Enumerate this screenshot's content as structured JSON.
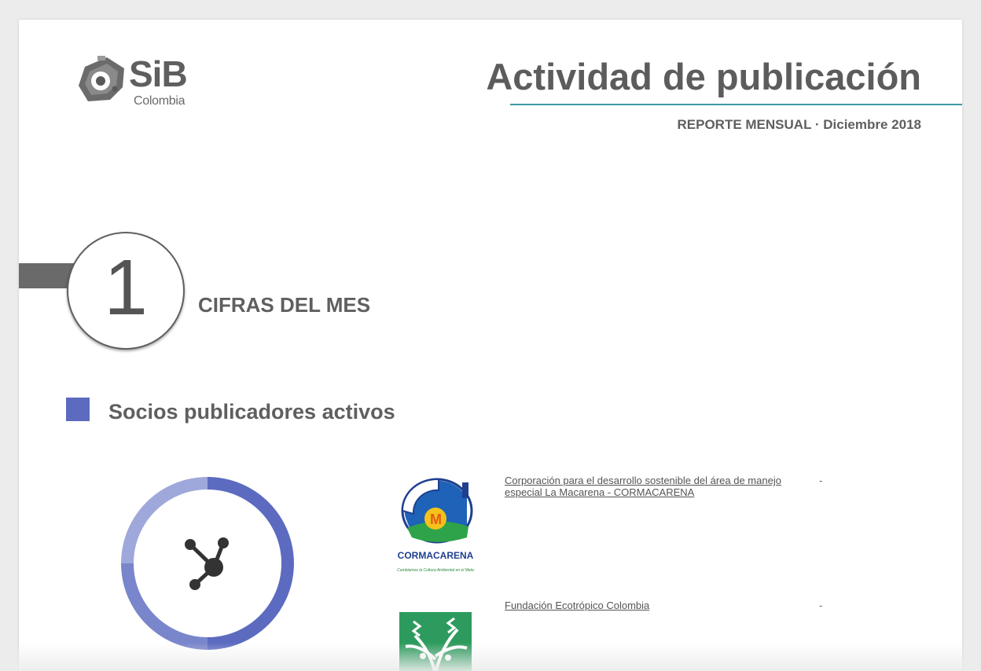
{
  "logo": {
    "name": "SiB",
    "subtitle": "Colombia"
  },
  "header": {
    "title": "Actividad de publicación",
    "subtitle": "REPORTE MENSUAL · Diciembre 2018"
  },
  "section": {
    "number": "1",
    "title": "CIFRAS DEL MES"
  },
  "subsection": {
    "title": "Socios publicadores activos",
    "bullet_color": "#5c6bc0"
  },
  "donut": {
    "icon": "network-nodes-icon",
    "colors": [
      "#5c6bc0",
      "#7986cb",
      "#9fa8da"
    ]
  },
  "partners": [
    {
      "name": "Corporación para el desarrollo sostenible del área de manejo especial La Macarena - CORMACARENA",
      "value": "-",
      "logo_text": "CORMACARENA",
      "logo_tagline": "Cambiamos la Cultura Ambiental en el Meta",
      "logo_icon": "cormacarena-logo"
    },
    {
      "name": "Fundación Ecotrópico Colombia",
      "value": "-",
      "logo_icon": "ecotropico-logo"
    }
  ],
  "colors": {
    "accent_rule": "#3e9aa2",
    "text": "#5f5f5f"
  }
}
